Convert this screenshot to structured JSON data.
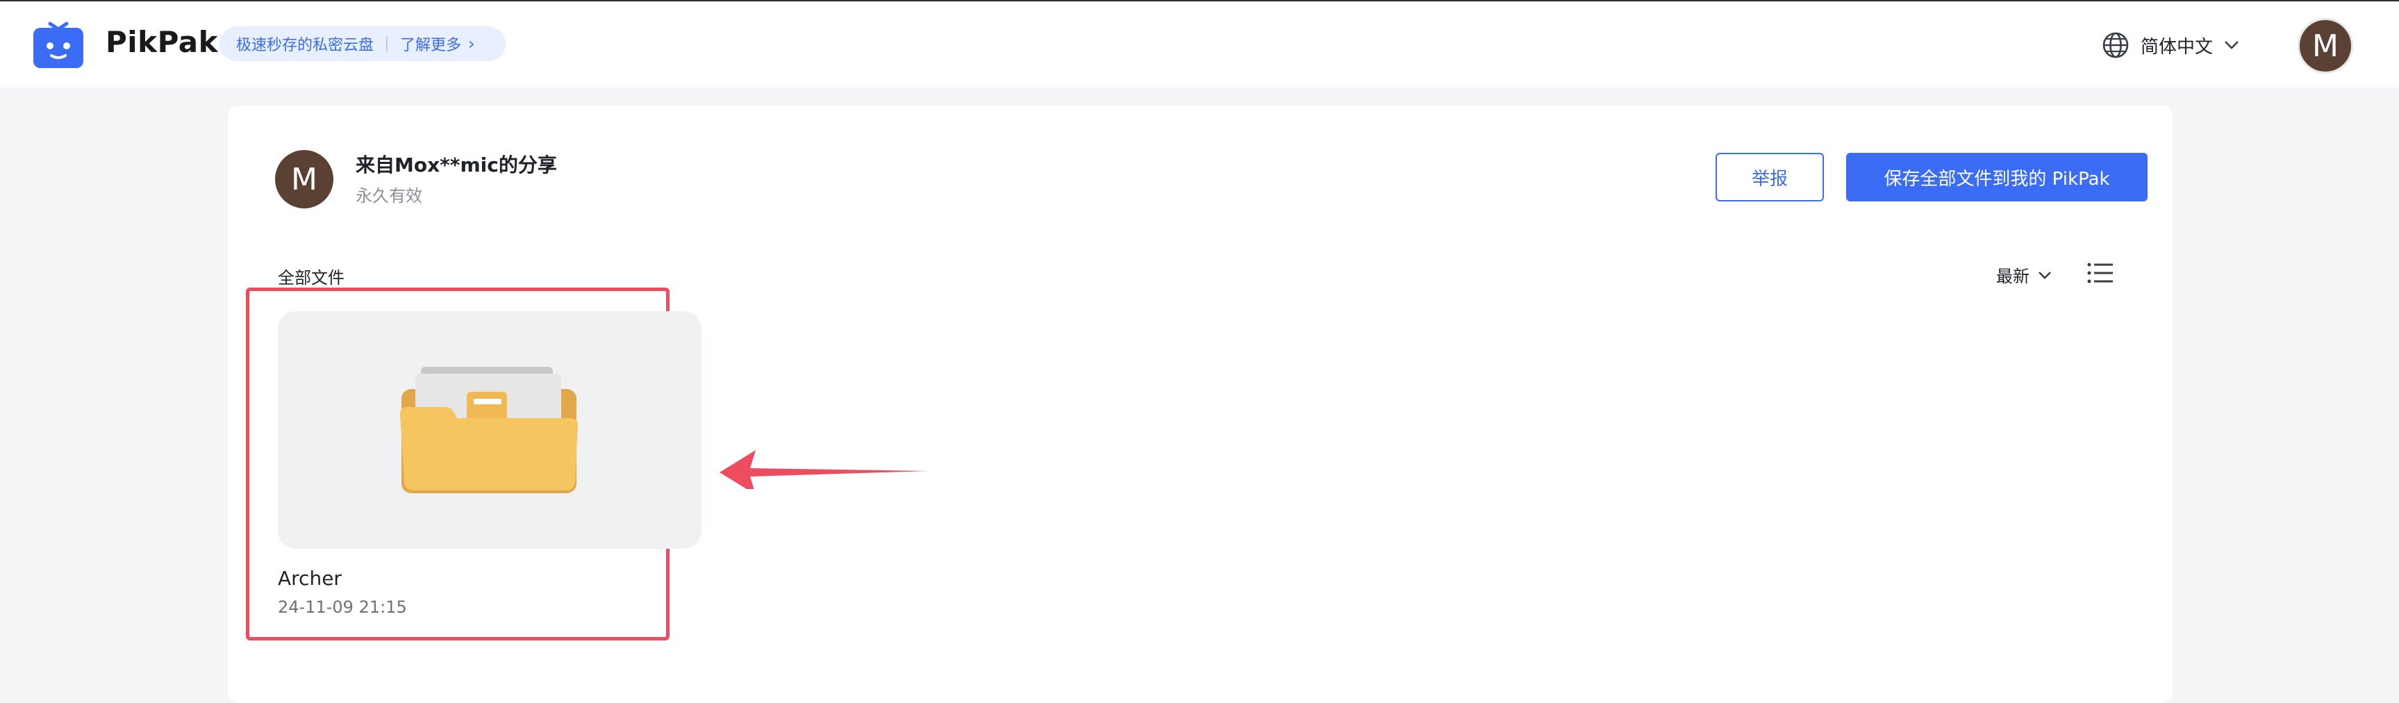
{
  "header": {
    "brand": "PikPak",
    "promo_text": "极速秒存的私密云盘",
    "promo_link": "了解更多",
    "language": "简体中文",
    "user_initial": "M"
  },
  "share": {
    "sharer_initial": "M",
    "title": "来自Mox**mic的分享",
    "validity": "永久有效",
    "report_label": "举报",
    "save_all_label": "保存全部文件到我的 PikPak"
  },
  "files": {
    "section_label": "全部文件",
    "sort_label": "最新",
    "items": [
      {
        "name": "Archer",
        "date": "24-11-09 21:15"
      }
    ]
  },
  "colors": {
    "accent": "#3b6cf6",
    "highlight": "#ee4c5f",
    "avatar": "#5b4034",
    "folder": "#f5c55f"
  }
}
